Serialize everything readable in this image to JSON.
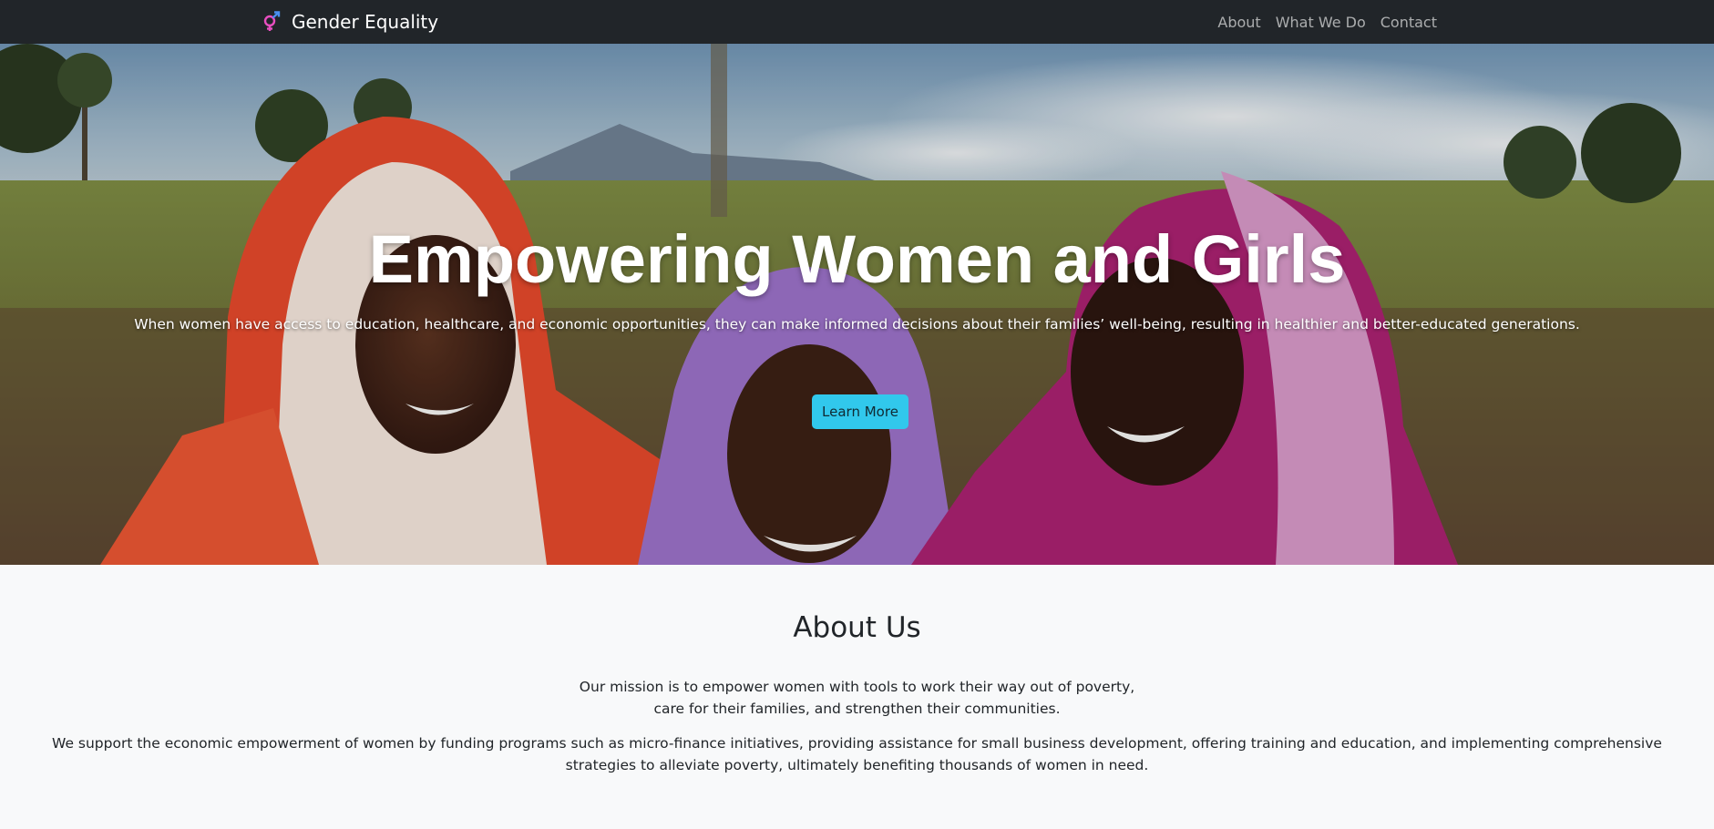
{
  "navbar": {
    "brand": "Gender Equality",
    "brand_icon": "gender-symbol-icon",
    "links": [
      "About",
      "What We Do",
      "Contact"
    ]
  },
  "hero": {
    "title": "Empowering Women and Girls",
    "text": "When women have access to education, healthcare, and economic opportunities, they can make informed decisions about their families’ well-being, resulting in healthier and better-educated generations.",
    "button": "Learn More"
  },
  "about": {
    "title": "About Us",
    "mission_line1": "Our mission is to empower women with tools to work their way out of poverty,",
    "mission_line2": "care for their families, and strengthen their communities.",
    "support": "We support the economic empowerment of women by funding programs such as micro-finance initiatives, providing assistance for small business development, offering training and education, and implementing comprehensive strategies to alleviate poverty, ultimately benefiting thousands of women in need."
  },
  "colors": {
    "navbar_bg": "#212529",
    "button_bg": "#31c8ec",
    "page_bg": "#f8f9fa"
  }
}
